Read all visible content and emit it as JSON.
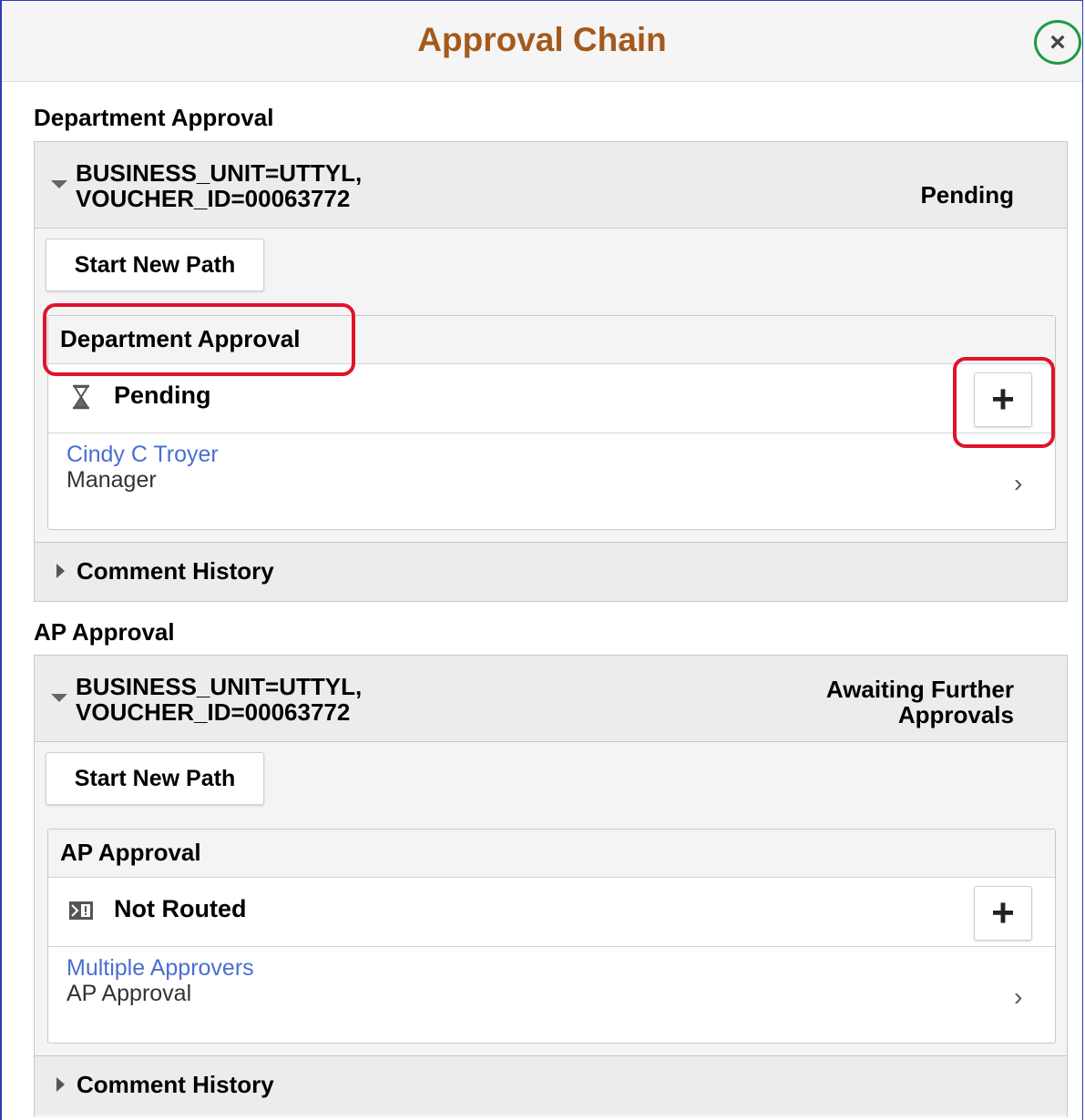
{
  "window": {
    "title": "Approval Chain",
    "close_glyph": "×"
  },
  "groups": [
    {
      "label": "Department Approval",
      "business_unit": "BUSINESS_UNIT=UTTYL,\nVOUCHER_ID=00063772",
      "status": "Pending",
      "start_new_path": "Start New Path",
      "stage": {
        "title": "Department Approval",
        "step_icon": "hourglass-icon",
        "step_status": "Pending",
        "add_button": "+",
        "approver_name": "Cindy C Troyer",
        "approver_role": "Manager",
        "chevron": "›"
      },
      "comment_history": "Comment History"
    },
    {
      "label": "AP Approval",
      "business_unit": "BUSINESS_UNIT=UTTYL,\nVOUCHER_ID=00063772",
      "status": "Awaiting Further\nApprovals",
      "start_new_path": "Start New Path",
      "stage": {
        "title": "AP Approval",
        "step_icon": "not-routed-icon",
        "step_status": "Not Routed",
        "add_button": "+",
        "approver_name": "Multiple Approvers",
        "approver_role": "AP Approval",
        "chevron": "›"
      },
      "comment_history": "Comment History"
    }
  ],
  "colors": {
    "title": "#a45a1c",
    "link": "#4a6fd1",
    "highlight_red": "#e0142a",
    "highlight_green": "#1e9a43",
    "frame": "#2b3cb6"
  }
}
